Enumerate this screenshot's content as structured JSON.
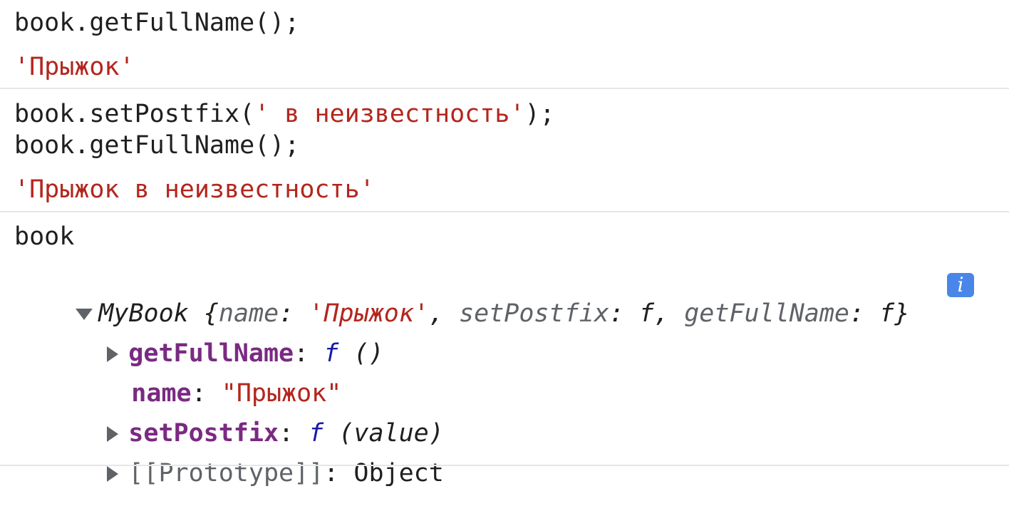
{
  "entries": {
    "e1": {
      "input": "book.getFullName();",
      "output": "'Прыжок'"
    },
    "e2": {
      "input_line1_prefix": "book.setPostfix(",
      "input_line1_string": "' в неизвестность'",
      "input_line1_suffix": ");",
      "input_line2": "book.getFullName();",
      "output": "'Прыжок в неизвестность'"
    },
    "e3": {
      "input": "book",
      "summary": {
        "class_name": "MyBook",
        "open_brace": " {",
        "name_key": "name",
        "colon": ": ",
        "name_value": "'Прыжок'",
        "comma1": ", ",
        "setPostfix_key": "setPostfix",
        "f_symbol": "f",
        "comma2": ", ",
        "getFullName_key": "getFullName",
        "close_brace": "}"
      },
      "info_icon_label": "i",
      "props": [
        {
          "key": "getFullName",
          "colon": ": ",
          "f": "f",
          "sig": " ()"
        },
        {
          "key": "name",
          "colon": ": ",
          "value": "\"Прыжок\""
        },
        {
          "key": "setPostfix",
          "colon": ": ",
          "f": "f",
          "sig": " (value)"
        },
        {
          "key": "[[Prototype]]",
          "colon": ": ",
          "value": "Object"
        }
      ]
    }
  }
}
